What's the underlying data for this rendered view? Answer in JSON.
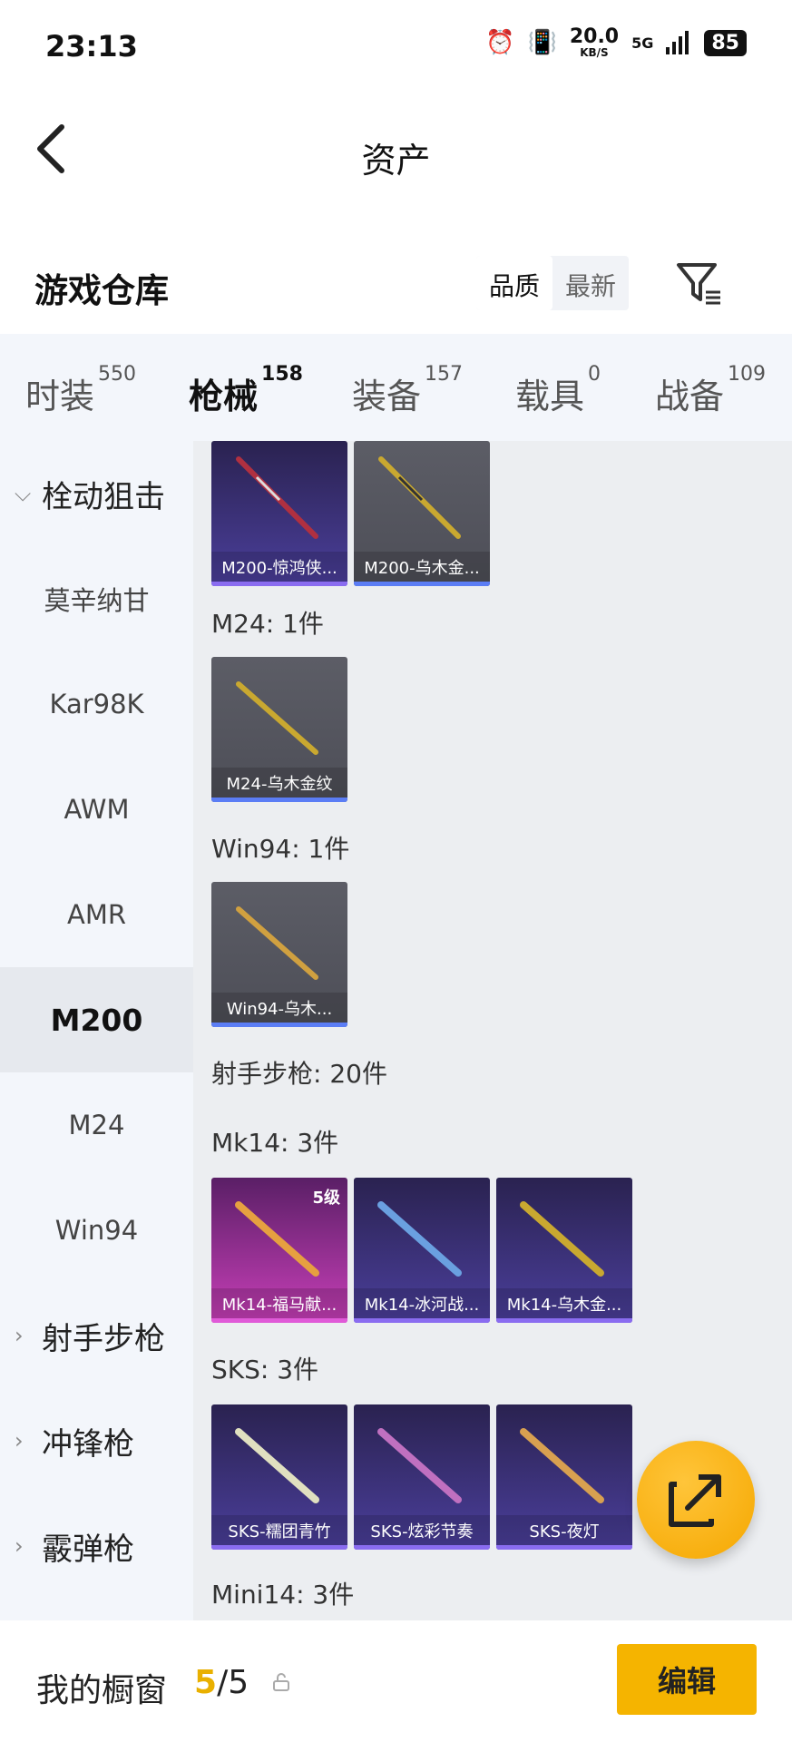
{
  "status": {
    "time": "23:13",
    "net_speed": "20.0",
    "net_unit": "KB/S",
    "signal": "5G",
    "battery": "85"
  },
  "header": {
    "title": "资产"
  },
  "section": {
    "title": "游戏仓库",
    "sort_quality": "品质",
    "sort_newest": "最新"
  },
  "tabs": [
    {
      "label": "时装",
      "count": "550"
    },
    {
      "label": "枪械",
      "count": "158"
    },
    {
      "label": "装备",
      "count": "157"
    },
    {
      "label": "载具",
      "count": "0"
    },
    {
      "label": "战备",
      "count": "109"
    }
  ],
  "sidebar": {
    "items": [
      {
        "label": "栓动狙击"
      },
      {
        "label": "莫辛纳甘"
      },
      {
        "label": "Kar98K"
      },
      {
        "label": "AWM"
      },
      {
        "label": "AMR"
      },
      {
        "label": "M200"
      },
      {
        "label": "M24"
      },
      {
        "label": "Win94"
      },
      {
        "label": "射手步枪"
      },
      {
        "label": "冲锋枪"
      },
      {
        "label": "霰弹枪"
      }
    ]
  },
  "content": {
    "m200_items": [
      "M200-惊鸿侠...",
      "M200-乌木金..."
    ],
    "m24_label": "M24: 1件",
    "m24_items": [
      "M24-乌木金纹"
    ],
    "win94_label": "Win94: 1件",
    "win94_items": [
      "Win94-乌木..."
    ],
    "dmr_label": "射手步枪: 20件",
    "mk14_label": "Mk14: 3件",
    "mk14_items": [
      "Mk14-福马献...",
      "Mk14-冰河战...",
      "Mk14-乌木金..."
    ],
    "mk14_level": "5级",
    "sks_label": "SKS: 3件",
    "sks_items": [
      "SKS-糯团青竹",
      "SKS-炫彩节奏",
      "SKS-夜灯"
    ],
    "mini14_label": "Mini14: 3件"
  },
  "bottom": {
    "title": "我的橱窗",
    "current": "5",
    "total": "/5",
    "edit": "编辑"
  },
  "colors": {
    "accent": "#f5b400"
  }
}
